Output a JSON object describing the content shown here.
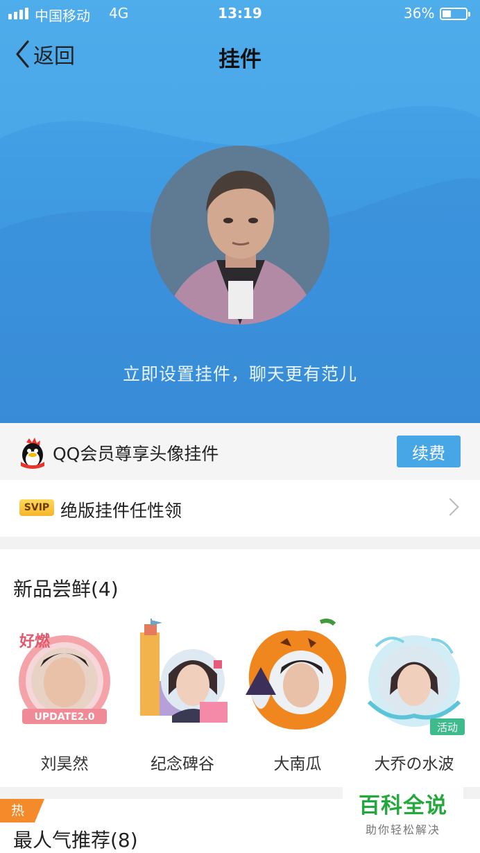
{
  "status_bar": {
    "carrier": "中国移动",
    "network": "4G",
    "time": "13:19",
    "battery_text": "36%",
    "battery_level": 0.36
  },
  "nav": {
    "back_label": "返回",
    "title": "挂件"
  },
  "hero": {
    "tip": "立即设置挂件，聊天更有范儿"
  },
  "vip_row": {
    "text": "QQ会员尊享头像挂件",
    "renew_label": "续费"
  },
  "svip_row": {
    "badge": "SVIP",
    "text": "绝版挂件任性领"
  },
  "new_section": {
    "title": "新品尝鲜(4)",
    "items": [
      {
        "name": "刘昊然",
        "art_text": "UPDATE2.0"
      },
      {
        "name": "纪念碑谷"
      },
      {
        "name": "大南瓜"
      },
      {
        "name": "大乔の水波",
        "tag": "活动"
      }
    ]
  },
  "hot_section": {
    "tag": "热",
    "title": "最人气推荐(8)"
  },
  "watermark": {
    "title": "百科全说",
    "subtitle": "助你轻松解决"
  },
  "colors": {
    "header_blue": "#3f9be2",
    "renew_button": "#47a6e6",
    "activity_tag": "#3dbb8d",
    "hot_tag": "#f58a2b",
    "svip_badge": "#f5b52b"
  }
}
